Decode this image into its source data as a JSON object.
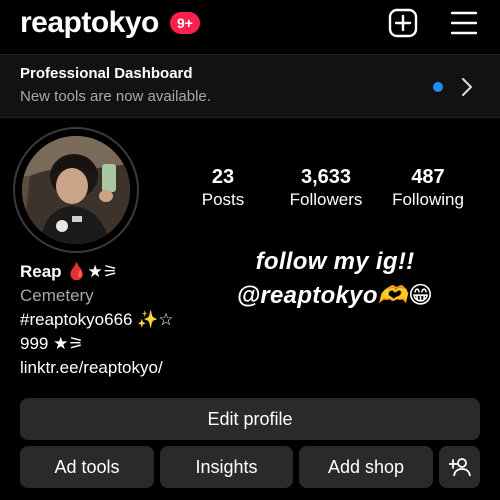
{
  "header": {
    "username": "reaptokyo",
    "notification_count": "9+",
    "add_icon": "plus-square-icon",
    "menu_icon": "hamburger-menu-icon"
  },
  "dashboard": {
    "title": "Professional Dashboard",
    "subtitle": "New tools are now available.",
    "dot_color": "#1f8ef1"
  },
  "stats": {
    "posts": {
      "value": "23",
      "label": "Posts"
    },
    "followers": {
      "value": "3,633",
      "label": "Followers"
    },
    "following": {
      "value": "487",
      "label": "Following"
    }
  },
  "bio": {
    "name": "Reap 🩸★⚞",
    "category": "Cemetery",
    "line1": "#reaptokyo666 ✨☆",
    "line2": "999 ★⚞",
    "link": "linktr.ee/reaptokyo/"
  },
  "promo": {
    "line1": "follow my ig!!",
    "line2": "@reaptokyo🫶😁"
  },
  "buttons": {
    "edit_profile": "Edit profile",
    "ad_tools": "Ad tools",
    "insights": "Insights",
    "add_shop": "Add shop",
    "discover_people_icon": "add-person-icon"
  },
  "colors": {
    "background": "#000000",
    "button": "#2a2a2a",
    "badge": "#ff1f4f"
  }
}
